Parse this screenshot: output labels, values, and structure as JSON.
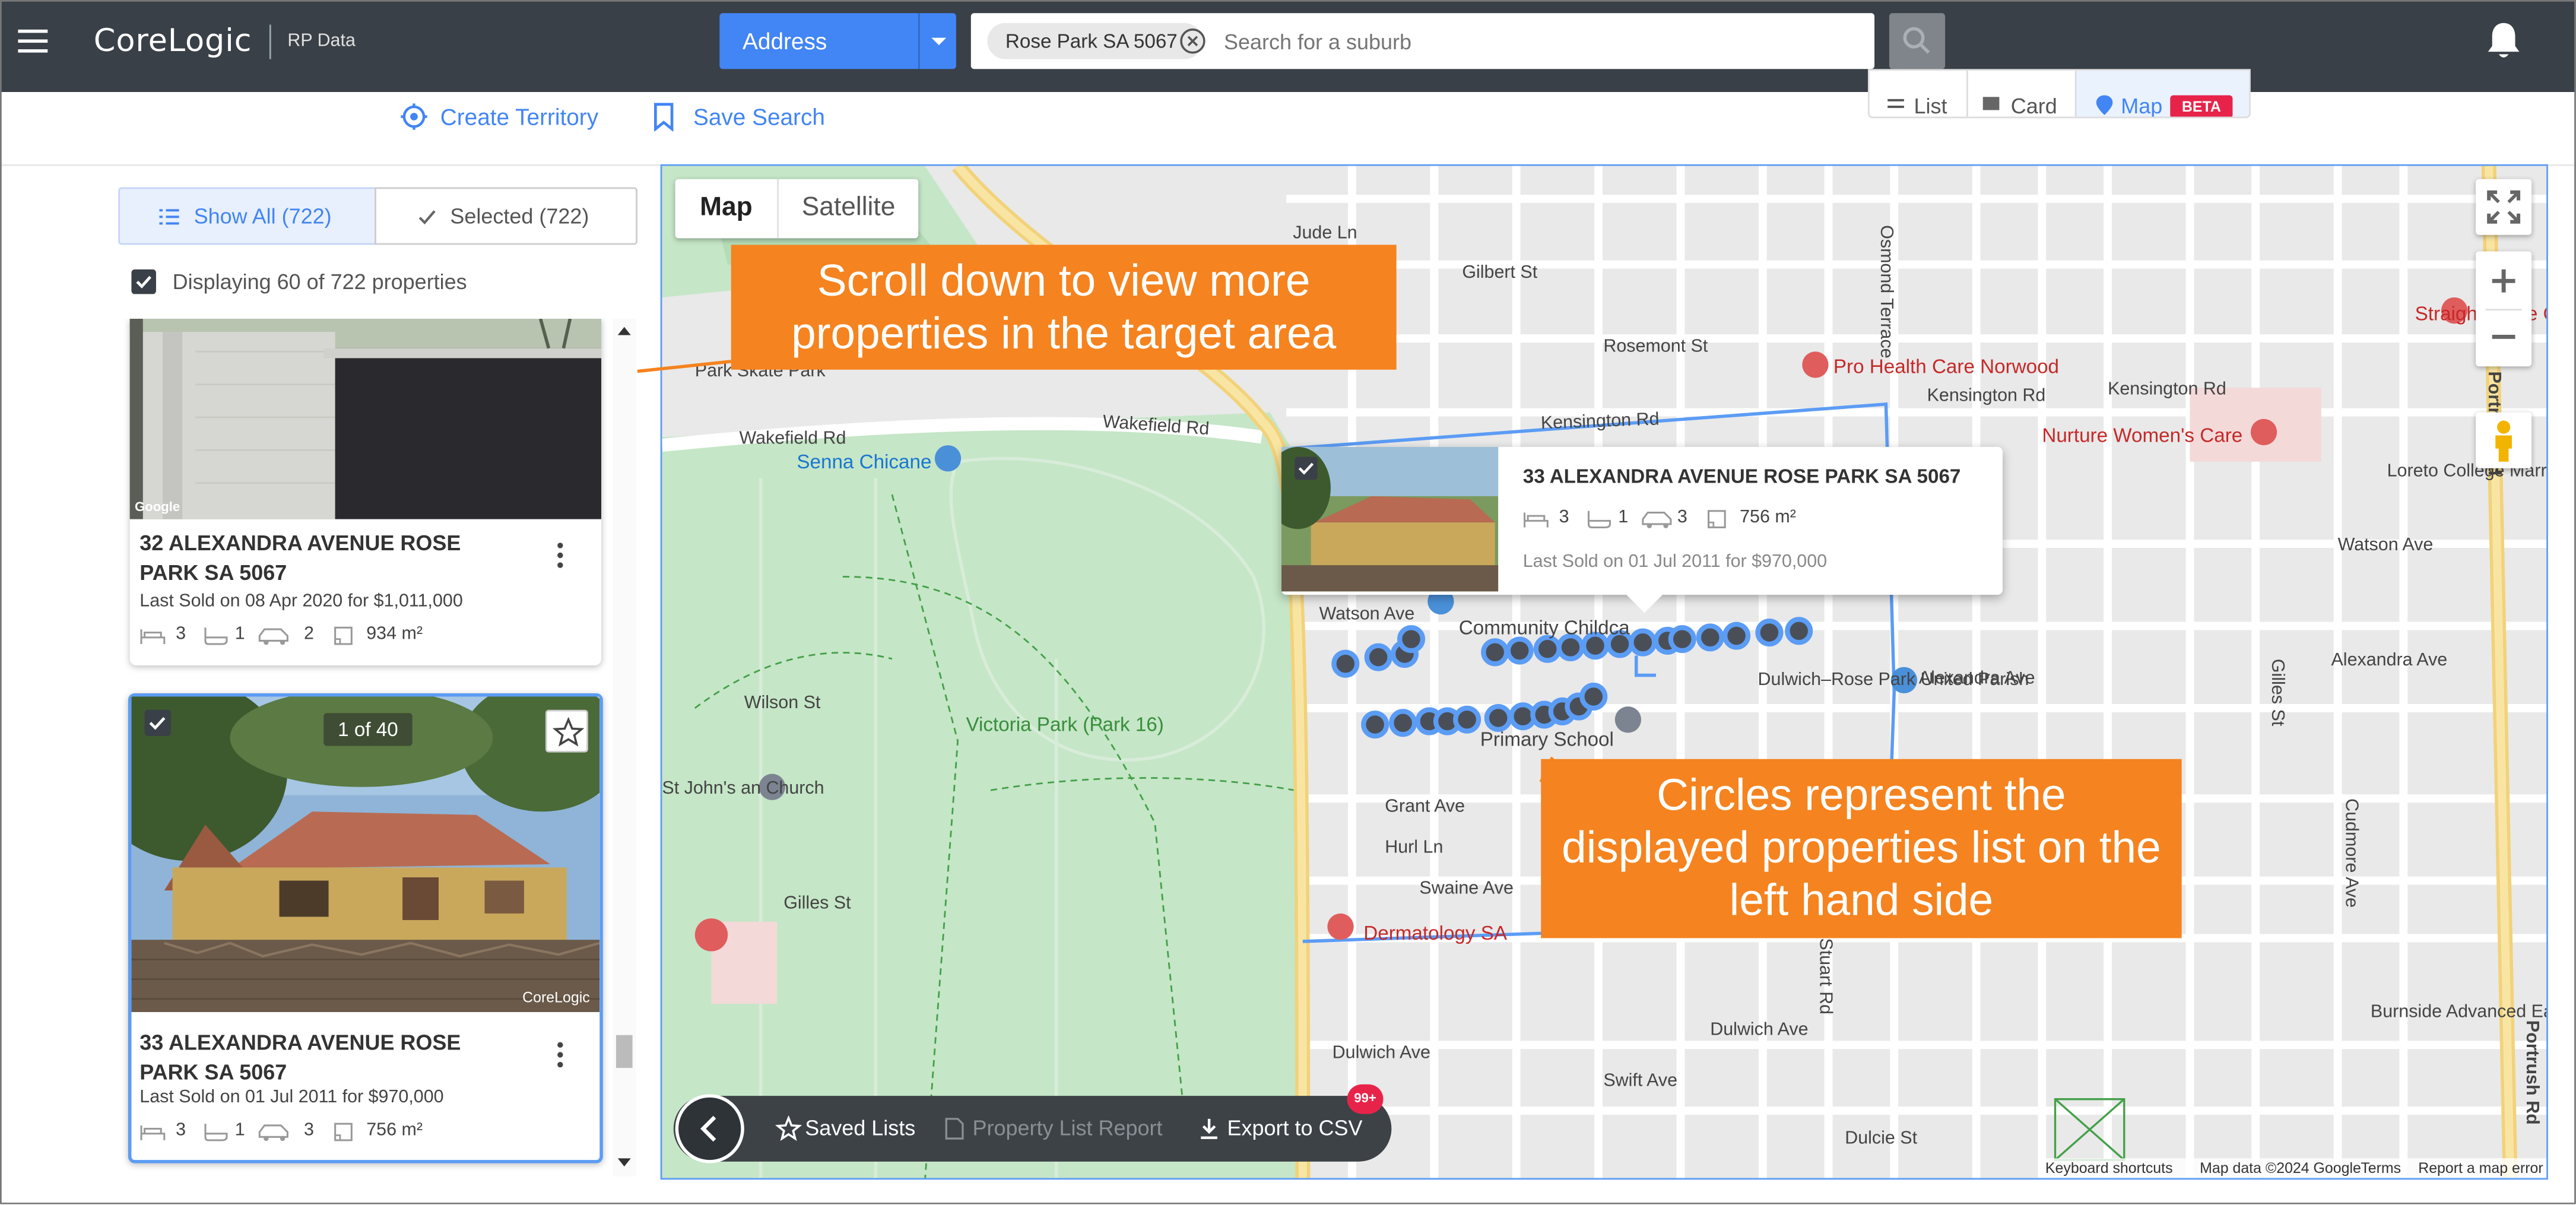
{
  "header": {
    "brand": "CoreLogic",
    "product": "RP Data",
    "search_type": "Address",
    "search_chip": "Rose Park SA 5067",
    "search_placeholder": "Search for a suburb"
  },
  "toolbar": {
    "create_territory": "Create Territory",
    "save_search": "Save Search",
    "view_list": "List",
    "view_card": "Card",
    "view_map": "Map",
    "beta_badge": "BETA"
  },
  "sidebar": {
    "tab_show_all": "Show All (722)",
    "tab_selected": "Selected (722)",
    "displaying": "Displaying 60 of 722 properties",
    "cards": [
      {
        "address": "32 ALEXANDRA AVENUE ROSE PARK SA 5067",
        "sold": "Last Sold on 08 Apr 2020 for $1,011,000",
        "beds": "3",
        "baths": "1",
        "cars": "2",
        "area": "934 m²"
      },
      {
        "photo_counter": "1 of 40",
        "watermark": "CoreLogic",
        "address": "33 ALEXANDRA AVENUE ROSE PARK SA 5067",
        "sold": "Last Sold on 01 Jul 2011 for $970,000",
        "beds": "3",
        "baths": "1",
        "cars": "3",
        "area": "756 m²"
      }
    ]
  },
  "map": {
    "type_map": "Map",
    "type_satellite": "Satellite",
    "popup": {
      "address": "33 ALEXANDRA AVENUE ROSE PARK SA 5067",
      "beds": "3",
      "baths": "1",
      "cars": "3",
      "area": "756 m²",
      "sold": "Last Sold on 01 Jul 2011 for $970,000"
    },
    "labels": {
      "wakefield_rd_1": "Wakefield Rd",
      "wakefield_rd_2": "Wakefield Rd",
      "senna_chicane": "Senna Chicane",
      "victoria_park": "Victoria Park (Park 16)",
      "kensington_rd_1": "Kensington Rd",
      "kensington_rd_2": "Kensington Rd",
      "kensington_rd_3": "Kensington Rd",
      "pro_health": "Pro Health Care Norwood",
      "nurture": "Nurture Women's Care",
      "straight_smile": "Straight Smile Centre - Norwood",
      "loreto": "Loreto College Marryatville",
      "alexandra_ave_1": "Alexandra Ave",
      "alexandra_ave_2": "Alexandra Ave",
      "dulwich": "Dulwich–Rose Park United Parish",
      "watson_ave_1": "Watson Ave",
      "watson_ave_2": "Watson Ave",
      "community": "Community Childca",
      "school": "Primary School",
      "grant_ave": "Grant Ave",
      "hurl_ln": "Hurl Ln",
      "swaine_ave": "Swaine Ave",
      "dermatology": "Dermatology SA",
      "dulwich_ave": "Dulwich Ave",
      "gilles_st": "Gilles St",
      "wilson_st": "Wilson St",
      "st_johns": "St John's an Church",
      "gilbert_st": "Gilbert St",
      "rosemont_st": "Rosemont St",
      "jude_ln": "Jude Ln",
      "osmond_tce": "Osmond Terrace",
      "portrush_rd": "Portrush Rd",
      "burnside": "Burnside Advanced Early Learning Centre",
      "swift_ave": "Swift Ave",
      "dulcie_st": "Dulcie St",
      "north_tce": "Park Skate Park",
      "cudmore_ave": "Cudmore Ave",
      "stuart_rd": "Stuart Rd"
    },
    "footer": {
      "shortcuts": "Keyboard shortcuts",
      "map_data": "Map data ©2024 Google",
      "terms": "Terms",
      "report": "Report a map error"
    },
    "bottom_bar": {
      "saved_lists": "Saved Lists",
      "property_report": "Property List Report",
      "export_csv": "Export to CSV",
      "badge": "99+"
    }
  },
  "callouts": {
    "scroll": "Scroll down to view more properties in the target area",
    "circles": "Circles represent the displayed properties list on the left hand side"
  },
  "colors": {
    "brand_blue": "#4285f4",
    "callout_orange": "#f5831f",
    "header_bg": "#3a4047",
    "marker_fill": "#4a4f57",
    "marker_ring": "#5b9cf5"
  }
}
